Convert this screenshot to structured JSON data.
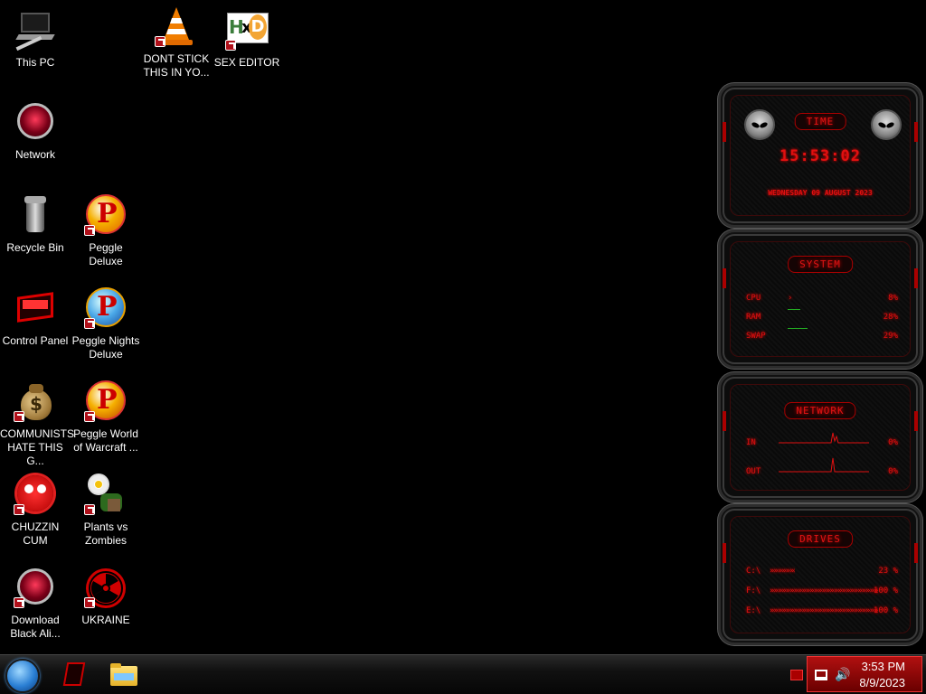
{
  "desktop_icons": [
    {
      "label": "This PC",
      "icon": "this-pc-icon"
    },
    {
      "label": "DONT STICK\nTHIS IN YO...",
      "icon": "vlc-cone-icon"
    },
    {
      "label": "SEX EDITOR",
      "icon": "hxd-icon"
    },
    {
      "label": "Network",
      "icon": "network-icon"
    },
    {
      "label": "Recycle Bin",
      "icon": "recycle-bin-icon"
    },
    {
      "label": "Peggle Deluxe",
      "icon": "peggle-icon"
    },
    {
      "label": "Control Panel",
      "icon": "control-panel-icon"
    },
    {
      "label": "Peggle Nights\nDeluxe",
      "icon": "peggle-nights-icon"
    },
    {
      "label": "COMMUNISTS\nHATE THIS G...",
      "icon": "money-bag-icon"
    },
    {
      "label": "Peggle World\nof Warcraft ...",
      "icon": "peggle-wow-icon"
    },
    {
      "label": "CHUZZIN\nCUM",
      "icon": "chuzzle-icon"
    },
    {
      "label": "Plants vs\nZombies",
      "icon": "plants-vs-zombies-icon"
    },
    {
      "label": "Download\nBlack Ali...",
      "icon": "black-alien-icon"
    },
    {
      "label": "UKRAINE",
      "icon": "radiation-icon"
    }
  ],
  "widgets": {
    "time": {
      "title": "TIME",
      "clock": "15:53:02",
      "date": "WEDNESDAY 09 AUGUST 2023"
    },
    "system": {
      "title": "SYSTEM",
      "rows": [
        {
          "label": "CPU",
          "value": "8%"
        },
        {
          "label": "RAM",
          "value": "28%"
        },
        {
          "label": "SWAP",
          "value": "29%"
        }
      ]
    },
    "network": {
      "title": "NETWORK",
      "rows": [
        {
          "label": "IN",
          "value": "0%"
        },
        {
          "label": "OUT",
          "value": "0%"
        }
      ]
    },
    "drives": {
      "title": "DRIVES",
      "rows": [
        {
          "label": "C:\\",
          "value": "23 %",
          "fill": 0.23
        },
        {
          "label": "F:\\",
          "value": "100 %",
          "fill": 1.0
        },
        {
          "label": "E:\\",
          "value": "100 %",
          "fill": 1.0
        }
      ]
    }
  },
  "taskbar": {
    "tray_time": "3:53 PM",
    "tray_date": "8/9/2023"
  },
  "colors": {
    "accent_red": "#e01010",
    "tray_red": "#b01010",
    "background": "#000000"
  }
}
